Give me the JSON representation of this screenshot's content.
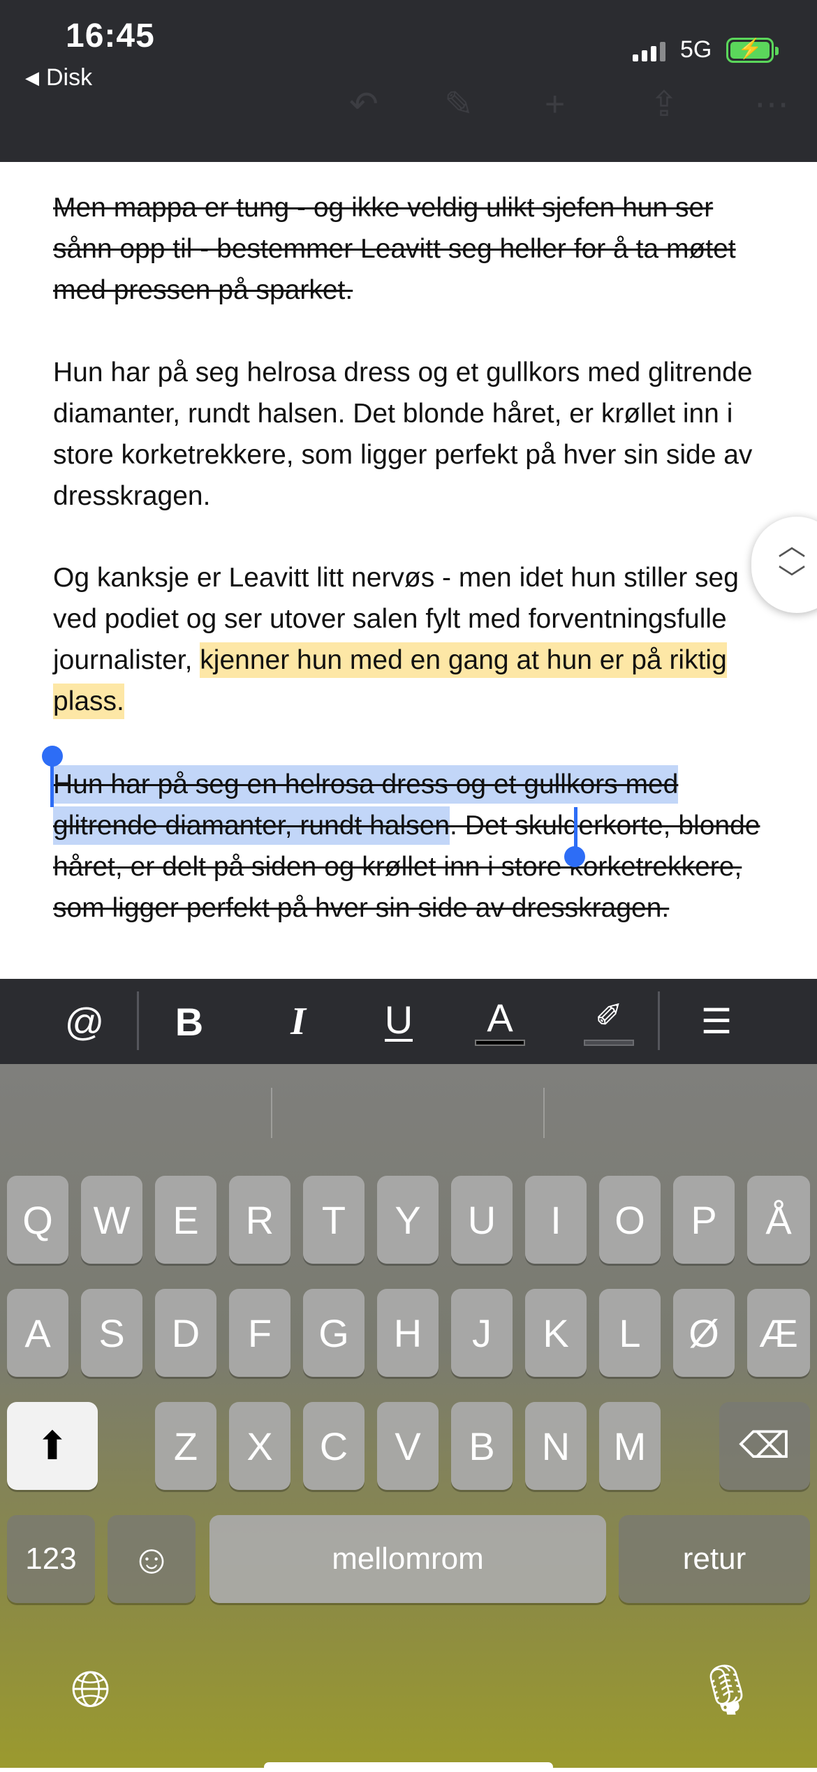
{
  "status_bar": {
    "time": "16:45",
    "back_label": "Disk",
    "network": "5G",
    "battery_color": "#5bd75b"
  },
  "document": {
    "para1": "Men mappa er tung - og ikke veldig ulikt sjefen hun ser sånn opp til - bestemmer Leavitt seg heller for å ta møtet med pressen på sparket.",
    "para2": "Hun har på seg helrosa dress og et gullkors med glitrende diamanter, rundt halsen. Det blonde håret, er krøllet inn i store korketrekkere, som ligger perfekt på hver sin side av dresskragen.",
    "para3_plain": "Og kanksje er Leavitt litt nervøs - men idet hun stiller seg ved podiet og ser utover salen fylt med forventningsfulle journalister, ",
    "para3_highlight": "kjenner hun med en gang at hun er på riktig plass.",
    "para4_selected": "Hun har på seg en helrosa dress og et gullkors med glitrende diamanter, rundt halsen",
    "para4_rest": ". Det skulderkorte, blonde håret, er delt på siden og krøllet inn i store korketrekkere, som ligger perfekt på hver sin side av dresskragen.",
    "highlight_color": "#fde7a6",
    "selection_color": "#c2d6f8"
  },
  "format_toolbar": {
    "mention": "@",
    "bold": "B",
    "italic": "I",
    "underline": "U",
    "text_color": "A",
    "text_color_value": "#000000"
  },
  "keyboard": {
    "row1": [
      "Q",
      "W",
      "E",
      "R",
      "T",
      "Y",
      "U",
      "I",
      "O",
      "P",
      "Å"
    ],
    "row2": [
      "A",
      "S",
      "D",
      "F",
      "G",
      "H",
      "J",
      "K",
      "L",
      "Ø",
      "Æ"
    ],
    "row3": [
      "Z",
      "X",
      "C",
      "V",
      "B",
      "N",
      "M"
    ],
    "numbers_label": "123",
    "space_label": "mellomrom",
    "return_label": "retur"
  }
}
